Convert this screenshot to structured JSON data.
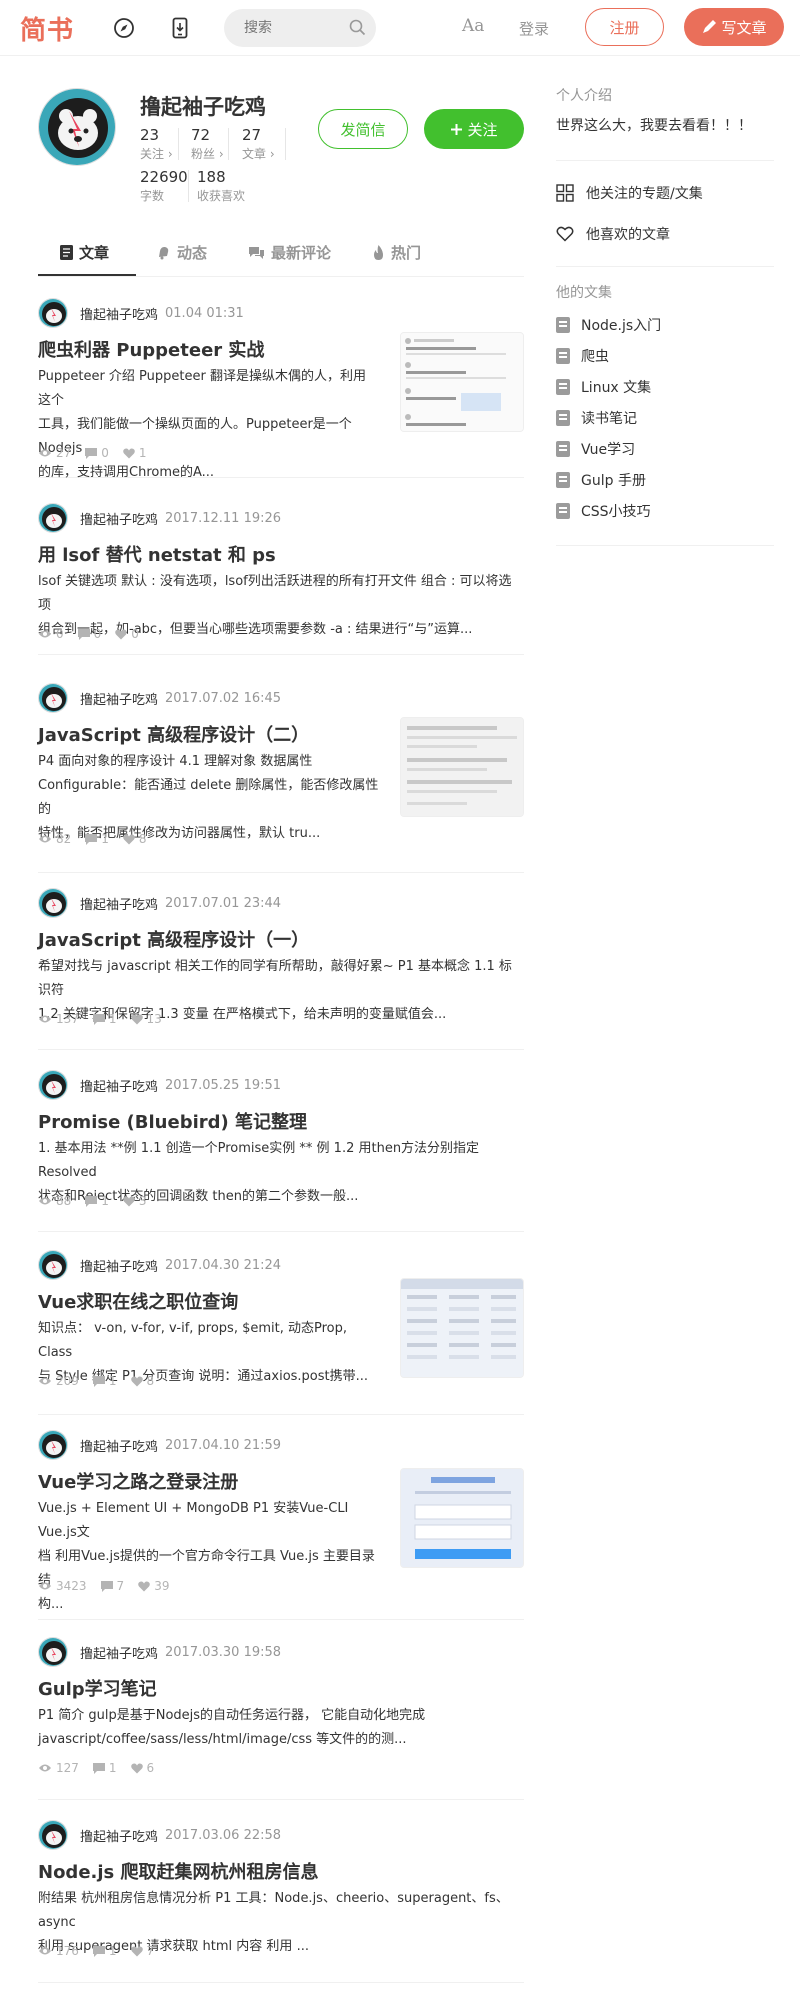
{
  "nav": {
    "logo": "简书",
    "search_placeholder": "搜索",
    "font_toggle": "Aa",
    "login": "登录",
    "register": "注册",
    "write": "写文章"
  },
  "profile": {
    "username": "撸起袖子吃鸡",
    "stats": [
      {
        "num": "23",
        "label": "关注 ›"
      },
      {
        "num": "72",
        "label": "粉丝 ›"
      },
      {
        "num": "27",
        "label": "文章 ›"
      },
      {
        "num": "22690",
        "label": "字数"
      },
      {
        "num": "188",
        "label": "收获喜欢"
      }
    ],
    "message_button": "发简信",
    "follow_button": "关注"
  },
  "tabs": [
    "文章",
    "动态",
    "最新评论",
    "热门"
  ],
  "articles": [
    {
      "author": "撸起袖子吃鸡",
      "time": "01.04 01:31",
      "title": "爬虫利器 Puppeteer 实战",
      "abstract_lines": [
        "Puppeteer 介绍 Puppeteer 翻译是操纵木偶的人，利用这个",
        "工具，我们能做一个操纵页面的人。Puppeteer是一个Nodejs",
        "的库，支持调用Chrome的A..."
      ],
      "views": "27",
      "comments": "0",
      "likes": "1"
    },
    {
      "author": "撸起袖子吃鸡",
      "time": "2017.12.11 19:26",
      "title": "用 lsof 替代 netstat 和 ps",
      "abstract_lines": [
        "lsof 关键选项 默认 : 没有选项，lsof列出活跃进程的所有打开文件 组合 : 可以将选项",
        "组合到一起，如-abc，但要当心哪些选项需要参数 -a : 结果进行“与”运算..."
      ],
      "views": "0",
      "comments": "0",
      "likes": "0"
    },
    {
      "author": "撸起袖子吃鸡",
      "time": "2017.07.02 16:45",
      "title": "JavaScript 高级程序设计（二）",
      "abstract_lines": [
        "P4 面向对象的程序设计 4.1 理解对象 数据属性",
        "Configurable：能否通过 delete 删除属性，能否修改属性的",
        "特性，能否把属性修改为访问器属性，默认 tru..."
      ],
      "views": "82",
      "comments": "1",
      "likes": "8"
    },
    {
      "author": "撸起袖子吃鸡",
      "time": "2017.07.01 23:44",
      "title": "JavaScript 高级程序设计（一）",
      "abstract_lines": [
        "希望对找与 javascript 相关工作的同学有所帮助，敲得好累~ P1 基本概念 1.1 标识符",
        "1.2 关键字和保留字 1.3 变量 在严格模式下，给未声明的变量赋值会..."
      ],
      "views": "137",
      "comments": "1",
      "likes": "13"
    },
    {
      "author": "撸起袖子吃鸡",
      "time": "2017.05.25 19:51",
      "title": "Promise (Bluebird) 笔记整理",
      "abstract_lines": [
        "1. 基本用法 **例 1.1 创造一个Promise实例 ** 例 1.2 用then方法分别指定Resolved",
        "状态和Reject状态的回调函数 then的第二个参数一般..."
      ],
      "views": "88",
      "comments": "1",
      "likes": "3"
    },
    {
      "author": "撸起袖子吃鸡",
      "time": "2017.04.30 21:24",
      "title": "Vue求职在线之职位查询",
      "abstract_lines": [
        "知识点：  v-on, v-for, v-if, props, $emit,  动态Prop,  Class",
        "与 Style 绑定 P1 分页查询 说明：通过axios.post携带..."
      ],
      "views": "209",
      "comments": "1",
      "likes": "8"
    },
    {
      "author": "撸起袖子吃鸡",
      "time": "2017.04.10 21:59",
      "title": "Vue学习之路之登录注册",
      "abstract_lines": [
        "Vue.js + Element UI + MongoDB P1 安装Vue-CLI Vue.js文",
        "档 利用Vue.js提供的一个官方命令行工具 Vue.js 主要目录结",
        "构..."
      ],
      "views": "3423",
      "comments": "7",
      "likes": "39"
    },
    {
      "author": "撸起袖子吃鸡",
      "time": "2017.03.30 19:58",
      "title": "Gulp学习笔记",
      "abstract_lines": [
        "P1 简介 gulp是基于Nodejs的自动任务运行器， 它能自动化地完成",
        "javascript/coffee/sass/less/html/image/css 等文件的的测..."
      ],
      "views": "127",
      "comments": "1",
      "likes": "6"
    },
    {
      "author": "撸起袖子吃鸡",
      "time": "2017.03.06 22:58",
      "title": "Node.js 爬取赶集网杭州租房信息",
      "abstract_lines": [
        "附结果 杭州租房信息情况分析 P1 工具：Node.js、cheerio、superagent、fs、async",
        "利用 superagent 请求获取 html 内容 利用 ..."
      ],
      "views": "176",
      "comments": "1",
      "likes": "7"
    }
  ],
  "sidebar": {
    "intro_title": "个人介绍",
    "intro": "世界这么大，我要去看看！！！",
    "followed_collections": "他关注的专题/文集",
    "liked_articles": "他喜欢的文章",
    "collections_title": "他的文集",
    "collections": [
      "Node.js入门",
      "爬虫",
      "Linux 文集",
      "读书笔记",
      "Vue学习",
      "Gulp 手册",
      "CSS小技巧"
    ]
  },
  "colors": {
    "brand": "#ea6f5a",
    "follow_green": "#42c02e",
    "muted": "#969696"
  }
}
